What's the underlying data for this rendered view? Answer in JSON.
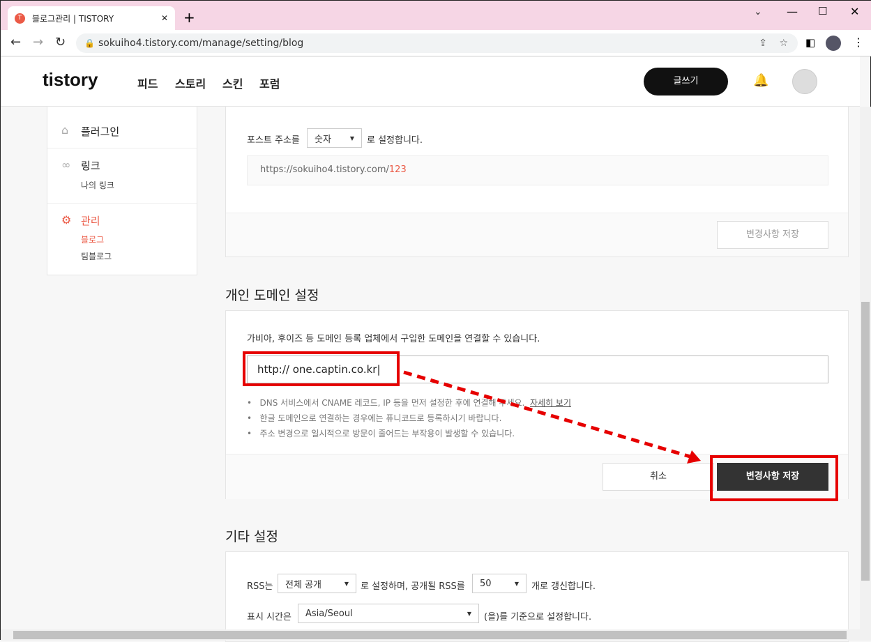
{
  "browser": {
    "tab_title": "블로그관리 | TISTORY",
    "new_tab": "+",
    "close": "✕",
    "url": "sokuiho4.tistory.com/manage/setting/blog"
  },
  "header": {
    "logo": "tistory",
    "nav": [
      "피드",
      "스토리",
      "스킨",
      "포럼"
    ],
    "write": "글쓰기"
  },
  "sidebar": {
    "plugin": "플러그인",
    "link": "링크",
    "link_sub": "나의 링크",
    "manage": "관리",
    "manage_sub": [
      "블로그",
      "팀블로그"
    ]
  },
  "post_url": {
    "prefix": "포스트 주소를",
    "select": "숫자",
    "suffix": "로 설정합니다.",
    "example_base": "https://sokuiho4.tistory.com/",
    "example_num": "123",
    "save": "변경사항 저장"
  },
  "domain": {
    "title": "개인 도메인 설정",
    "desc": "가비아, 후이즈 등 도메인 등록 업체에서 구입한 도메인을 연결할 수 있습니다.",
    "input_value": "http:// one.captin.co.kr",
    "notes": [
      "DNS 서비스에서 CNAME 레코드, IP 등을 먼저 설정한 후에 연결해 주세요.",
      "한글 도메인으로 연결하는 경우에는 퓨니코드로 등록하시기 바랍니다.",
      "주소 변경으로 일시적으로 방문이 줄어드는 부작용이 발생할 수 있습니다."
    ],
    "detail_link": "자세히 보기",
    "cancel": "취소",
    "save": "변경사항 저장"
  },
  "other": {
    "title": "기타 설정",
    "rss_label": "RSS는",
    "rss_select": "전체 공개",
    "rss_mid": "로 설정하며, 공개될 RSS를",
    "rss_count": "50",
    "rss_suffix": "개로 갱신합니다.",
    "time_label": "표시 시간은",
    "time_select": "Asia/Seoul",
    "time_suffix": "(을)를 기준으로 설정합니다."
  },
  "colors": {
    "accent": "#eb5a46",
    "annotation": "#e60000"
  }
}
